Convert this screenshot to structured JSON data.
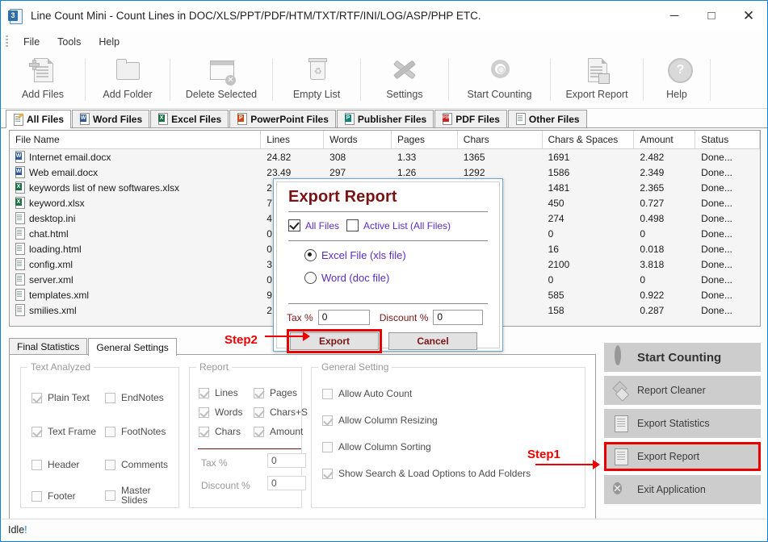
{
  "window": {
    "title": "Line Count Mini - Count Lines in DOC/XLS/PPT/PDF/HTM/TXT/RTF/INI/LOG/ASP/PHP ETC.",
    "icon_label": "3",
    "minimize": "─",
    "maximize": "□",
    "close": "✕"
  },
  "menu": {
    "items": [
      "File",
      "Tools",
      "Help"
    ]
  },
  "toolbar": {
    "items": [
      {
        "label": "Add Files",
        "icon": "add-files-icon"
      },
      {
        "label": "Add Folder",
        "icon": "add-folder-icon"
      },
      {
        "label": "Delete Selected",
        "icon": "delete-selected-icon"
      },
      {
        "label": "Empty List",
        "icon": "empty-list-icon"
      },
      {
        "label": "Settings",
        "icon": "settings-icon"
      },
      {
        "label": "Start Counting",
        "icon": "start-counting-icon"
      },
      {
        "label": "Export Report",
        "icon": "export-report-icon"
      },
      {
        "label": "Help",
        "icon": "help-icon"
      }
    ]
  },
  "file_tabs": [
    {
      "label": "All Files",
      "active": true
    },
    {
      "label": "Word Files",
      "active": false
    },
    {
      "label": "Excel Files",
      "active": false
    },
    {
      "label": "PowerPoint Files",
      "active": false
    },
    {
      "label": "Publisher Files",
      "active": false
    },
    {
      "label": "PDF Files",
      "active": false
    },
    {
      "label": "Other Files",
      "active": false
    }
  ],
  "grid": {
    "columns": [
      "File Name",
      "Lines",
      "Words",
      "Pages",
      "Chars",
      "Chars & Spaces",
      "Amount",
      "Status"
    ],
    "rows": [
      {
        "name": "Internet email.docx",
        "type": "word",
        "lines": "24.82",
        "words": "308",
        "pages": "1.33",
        "chars": "1365",
        "chars_spaces": "1691",
        "amount": "2.482",
        "status": "Done..."
      },
      {
        "name": "Web email.docx",
        "type": "word",
        "lines": "23.49",
        "words": "297",
        "pages": "1.26",
        "chars": "1292",
        "chars_spaces": "1586",
        "amount": "2.349",
        "status": "Done..."
      },
      {
        "name": "keywords list of new softwares.xlsx",
        "type": "excel",
        "lines": "2",
        "words": "",
        "pages": "",
        "chars": "",
        "chars_spaces": "1481",
        "amount": "2.365",
        "status": "Done..."
      },
      {
        "name": "keyword.xlsx",
        "type": "excel",
        "lines": "7",
        "words": "",
        "pages": "",
        "chars": "",
        "chars_spaces": "450",
        "amount": "0.727",
        "status": "Done..."
      },
      {
        "name": "desktop.ini",
        "type": "other",
        "lines": "4",
        "words": "",
        "pages": "",
        "chars": "",
        "chars_spaces": "274",
        "amount": "0.498",
        "status": "Done..."
      },
      {
        "name": "chat.html",
        "type": "other",
        "lines": "0",
        "words": "",
        "pages": "",
        "chars": "",
        "chars_spaces": "0",
        "amount": "0",
        "status": "Done..."
      },
      {
        "name": "loading.html",
        "type": "other",
        "lines": "0",
        "words": "",
        "pages": "",
        "chars": "",
        "chars_spaces": "16",
        "amount": "0.018",
        "status": "Done..."
      },
      {
        "name": "config.xml",
        "type": "other",
        "lines": "3",
        "words": "",
        "pages": "",
        "chars": "",
        "chars_spaces": "2100",
        "amount": "3.818",
        "status": "Done..."
      },
      {
        "name": "server.xml",
        "type": "other",
        "lines": "0",
        "words": "",
        "pages": "",
        "chars": "",
        "chars_spaces": "0",
        "amount": "0",
        "status": "Done..."
      },
      {
        "name": "templates.xml",
        "type": "other",
        "lines": "9",
        "words": "",
        "pages": "",
        "chars": "",
        "chars_spaces": "585",
        "amount": "0.922",
        "status": "Done..."
      },
      {
        "name": "smilies.xml",
        "type": "other",
        "lines": "2",
        "words": "",
        "pages": "",
        "chars": "",
        "chars_spaces": "158",
        "amount": "0.287",
        "status": "Done..."
      }
    ]
  },
  "bottom_tabs": [
    {
      "label": "Final Statistics",
      "active": false
    },
    {
      "label": "General Settings",
      "active": true
    }
  ],
  "settings": {
    "text_analyzed": {
      "caption": "Text Analyzed",
      "items": [
        {
          "label": "Plain Text",
          "checked": true
        },
        {
          "label": "EndNotes",
          "checked": false
        },
        {
          "label": "Text Frame",
          "checked": true
        },
        {
          "label": "FootNotes",
          "checked": false
        },
        {
          "label": "Header",
          "checked": false
        },
        {
          "label": "Comments",
          "checked": false
        },
        {
          "label": "Footer",
          "checked": false
        },
        {
          "label": "Master Slides",
          "checked": false
        }
      ]
    },
    "report": {
      "caption": "Report",
      "items": [
        {
          "label": "Lines",
          "checked": true
        },
        {
          "label": "Pages",
          "checked": true
        },
        {
          "label": "Words",
          "checked": true
        },
        {
          "label": "Chars+S",
          "checked": true
        },
        {
          "label": "Chars",
          "checked": true
        },
        {
          "label": "Amount",
          "checked": true
        }
      ],
      "tax_label": "Tax %",
      "tax_value": "0",
      "discount_label": "Discount %",
      "discount_value": "0"
    },
    "general": {
      "caption": "General Setting",
      "items": [
        {
          "label": "Allow Auto Count",
          "checked": false
        },
        {
          "label": "Allow Column Resizing",
          "checked": true
        },
        {
          "label": "Allow Column Sorting",
          "checked": false
        },
        {
          "label": "Show Search & Load Options to Add Folders",
          "checked": true
        }
      ]
    }
  },
  "actions": [
    {
      "label": "Start Counting",
      "icon": "gear-icon",
      "highlighted": false,
      "big": true
    },
    {
      "label": "Report Cleaner",
      "icon": "brush-icon",
      "highlighted": false,
      "big": false
    },
    {
      "label": "Export Statistics",
      "icon": "statistics-icon",
      "highlighted": false,
      "big": false
    },
    {
      "label": "Export Report",
      "icon": "export-doc-icon",
      "highlighted": true,
      "big": false
    },
    {
      "label": "Exit Application",
      "icon": "exit-icon",
      "highlighted": false,
      "big": false
    }
  ],
  "dialog": {
    "title": "Export Report",
    "all_files": {
      "label": "All Files",
      "checked": true
    },
    "active_list": {
      "label": "Active List (All Files)",
      "checked": false
    },
    "format_options": [
      {
        "label": "Excel File (xls file)",
        "selected": true
      },
      {
        "label": "Word (doc file)",
        "selected": false
      }
    ],
    "tax_label": "Tax %",
    "tax_value": "0",
    "discount_label": "Discount %",
    "discount_value": "0",
    "export_button": "Export",
    "cancel_button": "Cancel"
  },
  "annotations": [
    {
      "label": "Step1",
      "target": "export-report-side-button"
    },
    {
      "label": "Step2",
      "target": "dialog-export-button"
    }
  ],
  "statusbar": {
    "text": "Idle",
    "suffix": "!"
  },
  "colors": {
    "window_border": "#0a84d8",
    "dialog_title": "#7a1414",
    "dialog_option_text": "#5b2bbf",
    "annotation_red": "#ee0000",
    "highlight_red": "#e80000",
    "action_button_bg": "#cdcdcd"
  }
}
